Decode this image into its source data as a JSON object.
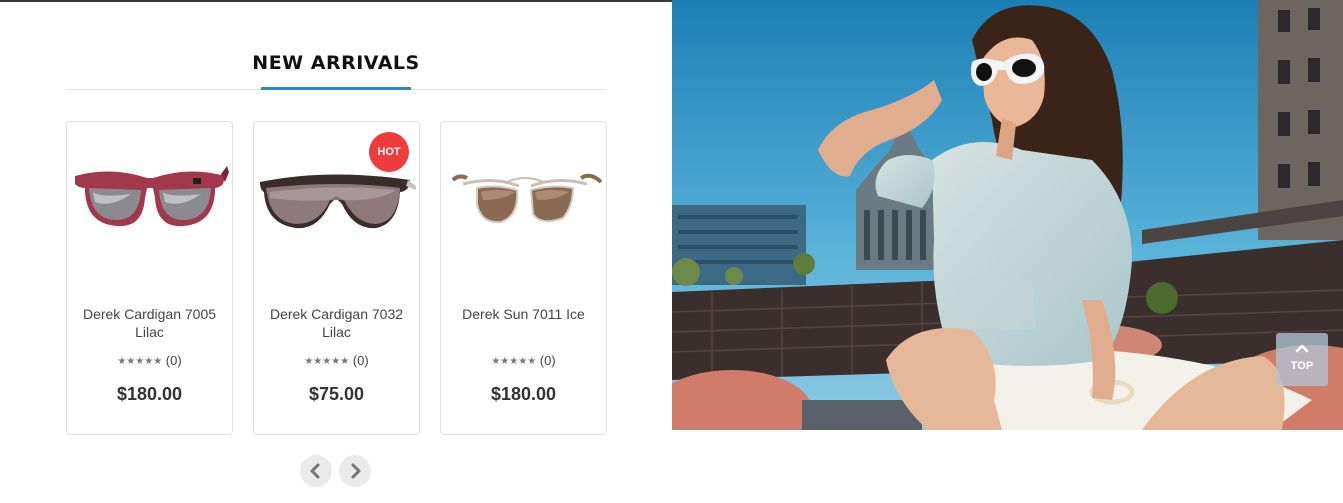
{
  "section": {
    "title": "NEW ARRIVALS"
  },
  "products": [
    {
      "name": "Derek Cardigan 7005 Lilac",
      "rating_count": "(0)",
      "price": "$180.00",
      "badge": "",
      "image_icon": "red-frame-sunglasses"
    },
    {
      "name": "Derek Cardigan 7032 Lilac",
      "rating_count": "(0)",
      "price": "$75.00",
      "badge": "HOT",
      "image_icon": "shield-sunglasses"
    },
    {
      "name": "Derek Sun 7011 Ice",
      "rating_count": "(0)",
      "price": "$180.00",
      "badge": "",
      "image_icon": "aviator-sunglasses"
    }
  ],
  "rating_stars": "★★★★★",
  "carousel": {
    "prev_icon": "chevron-left-icon",
    "next_icon": "chevron-right-icon"
  },
  "scroll_top": {
    "label": "TOP",
    "icon": "chevron-up-icon"
  },
  "colors": {
    "accent": "#2f86c6",
    "hot_badge": "#ee3b3b",
    "price": "#333333"
  }
}
